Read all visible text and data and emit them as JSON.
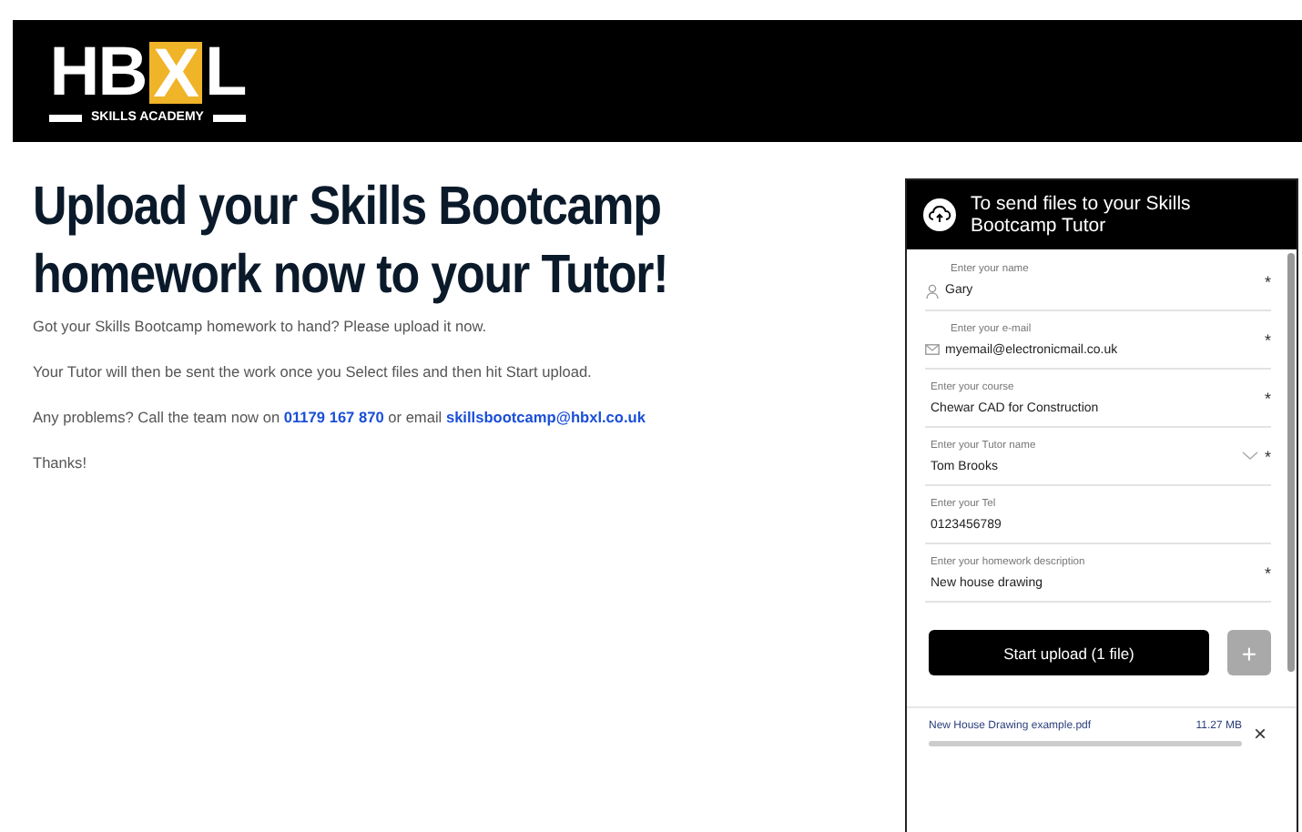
{
  "logo": {
    "parts": [
      {
        "text": "HB",
        "highlighted": false
      },
      {
        "text": "X",
        "highlighted": true
      },
      {
        "text": "L",
        "highlighted": false
      }
    ],
    "tagline": "SKILLS ACADEMY"
  },
  "heading": "Upload your Skills Bootcamp homework now to your Tutor!",
  "paragraphs": [
    {
      "parts": [
        {
          "text": "Got your Skills Bootcamp homework to hand? Please upload it now.",
          "link": false
        }
      ]
    },
    {
      "parts": [
        {
          "text": "Your Tutor will then be sent the work once you Select files and then hit Start upload.",
          "link": false
        }
      ]
    },
    {
      "parts": [
        {
          "text": "Any problems? Call the team now on ",
          "link": false
        },
        {
          "text": "01179 167 870",
          "link": true
        },
        {
          "text": " or email ",
          "link": false
        },
        {
          "text": "skillsbootcamp@hbxl.co.uk",
          "link": true
        }
      ]
    },
    {
      "parts": [
        {
          "text": "Thanks!",
          "link": false
        }
      ]
    }
  ],
  "upload_panel": {
    "title": "To send files to your Skills Bootcamp Tutor",
    "fields": [
      {
        "label": "Enter your name",
        "value": "Gary",
        "kind": "person",
        "required": true,
        "dropdown": false
      },
      {
        "label": "Enter your e-mail",
        "value": "myemail@electronicmail.co.uk",
        "kind": "mail",
        "required": true,
        "dropdown": false
      },
      {
        "label": "Enter your course",
        "value": "Chewar CAD for Construction",
        "kind": "plain",
        "required": true,
        "dropdown": false
      },
      {
        "label": "Enter your Tutor name",
        "value": "Tom Brooks",
        "kind": "plain",
        "required": true,
        "dropdown": true
      },
      {
        "label": "Enter your Tel",
        "value": "0123456789",
        "kind": "plain",
        "required": false,
        "dropdown": false
      },
      {
        "label": "Enter your homework description",
        "value": "New house drawing",
        "kind": "plain",
        "required": true,
        "dropdown": false
      }
    ],
    "required_mark": "*",
    "upload_button": "Start upload (1 file)",
    "add_button": {
      "label": "+",
      "disabled": true
    },
    "files": [
      {
        "name": "New House Drawing example.pdf",
        "size": "11.27 MB",
        "remove": "×"
      }
    ]
  }
}
